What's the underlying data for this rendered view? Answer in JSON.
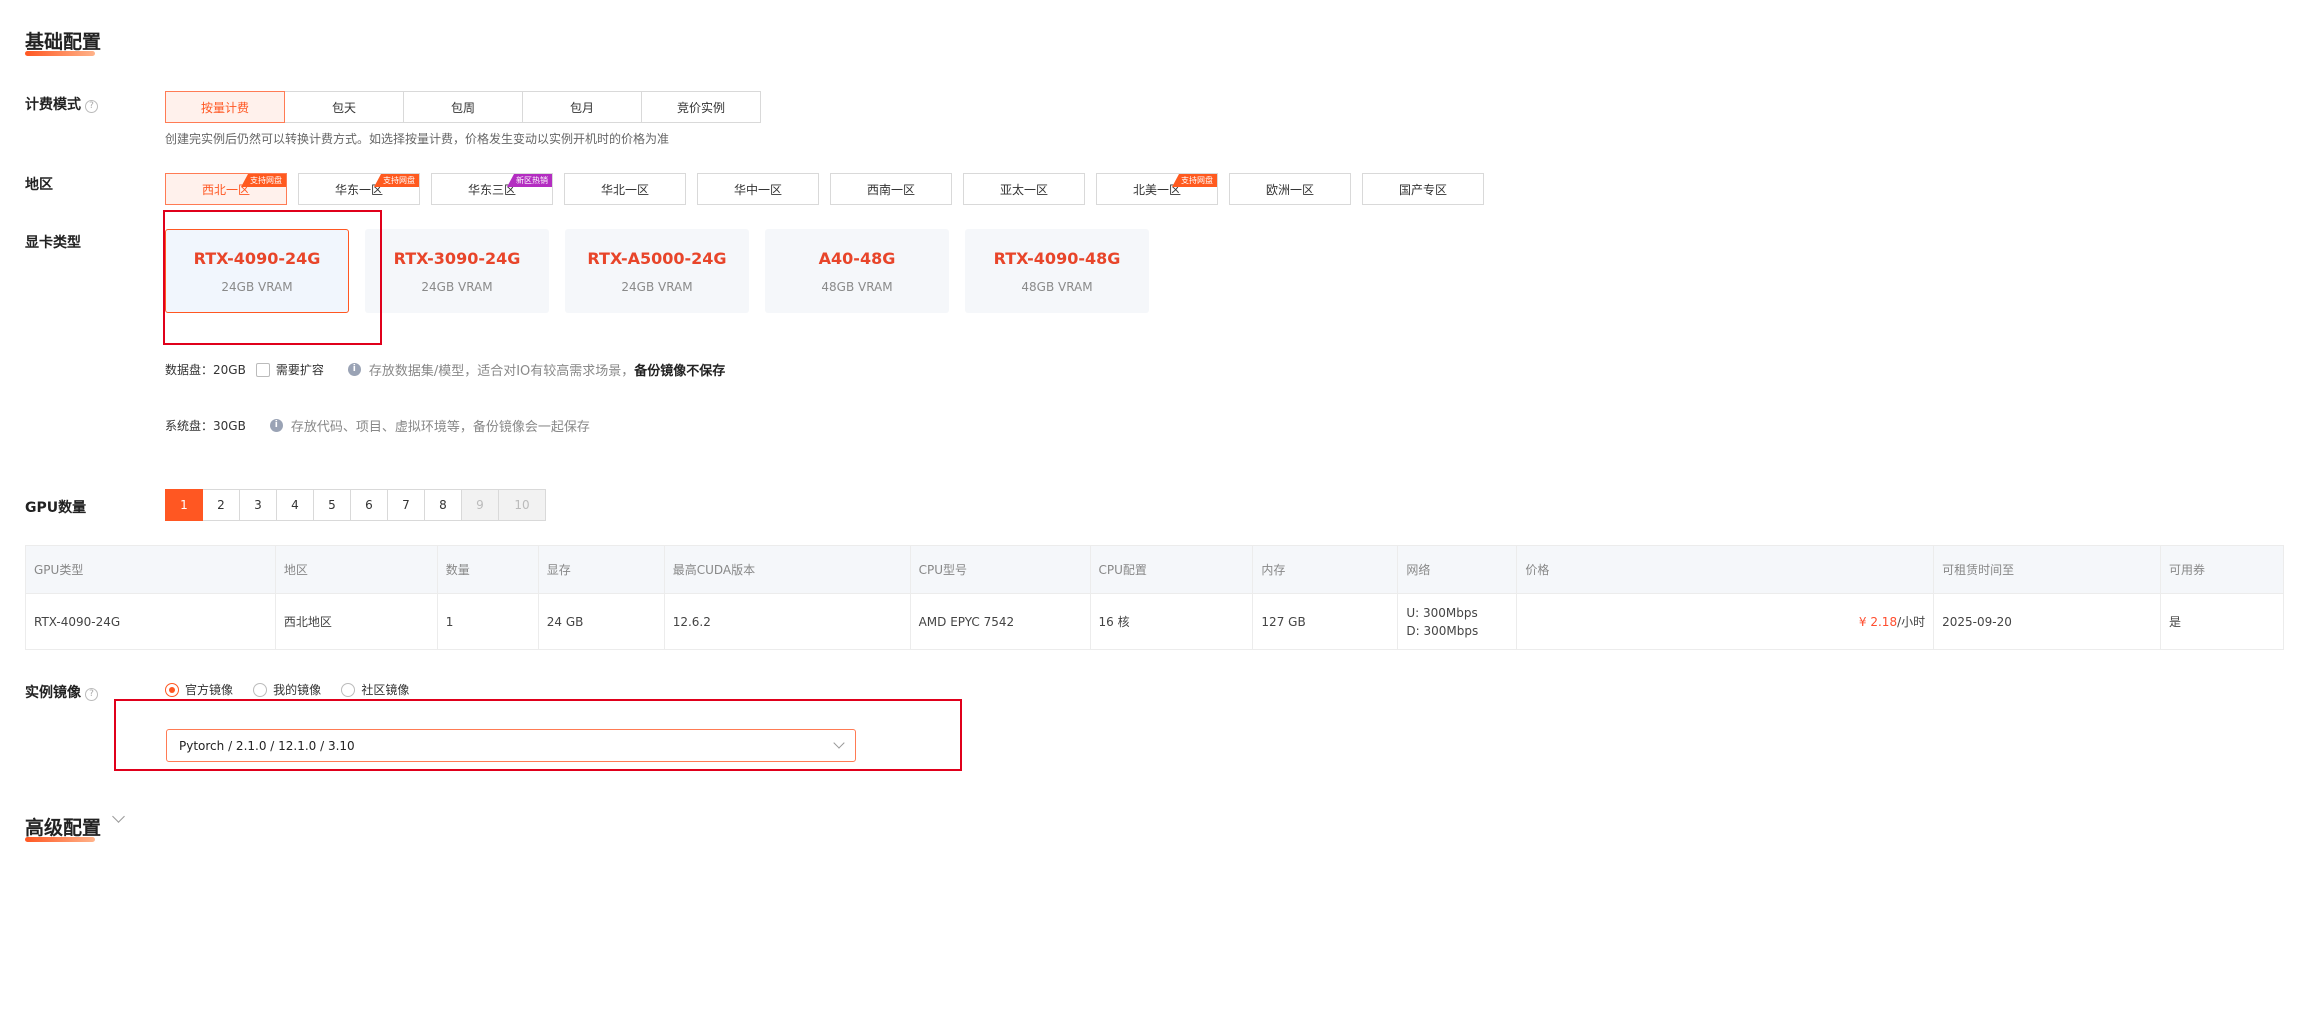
{
  "basic": {
    "title": "基础配置",
    "billing": {
      "label": "计费模式",
      "help": "?",
      "options": [
        "按量计费",
        "包天",
        "包周",
        "包月",
        "竞价实例"
      ],
      "selected": "按量计费",
      "hint": "创建完实例后仍然可以转换计费方式。如选择按量计费，价格发生变动以实例开机时的价格为准"
    },
    "region": {
      "label": "地区",
      "options": [
        {
          "name": "西北一区",
          "badge": "支持网盘",
          "active": true
        },
        {
          "name": "华东一区",
          "badge": "支持网盘"
        },
        {
          "name": "华东三区",
          "badge": "新区热销"
        },
        {
          "name": "华北一区"
        },
        {
          "name": "华中一区"
        },
        {
          "name": "西南一区"
        },
        {
          "name": "亚太一区"
        },
        {
          "name": "北美一区",
          "badge": "支持网盘"
        },
        {
          "name": "欧洲一区"
        },
        {
          "name": "国产专区"
        }
      ]
    },
    "gpu_type": {
      "label": "显卡类型",
      "cards": [
        {
          "name": "RTX-4090-24G",
          "vram": "24GB VRAM",
          "active": true
        },
        {
          "name": "RTX-3090-24G",
          "vram": "24GB VRAM"
        },
        {
          "name": "RTX-A5000-24G",
          "vram": "24GB VRAM"
        },
        {
          "name": "A40-48G",
          "vram": "48GB VRAM"
        },
        {
          "name": "RTX-4090-48G",
          "vram": "48GB VRAM"
        }
      ]
    },
    "data_disk": {
      "label": "数据盘：",
      "size": "20GB",
      "expand_label": "需要扩容",
      "info_icon": "i",
      "info": "存放数据集/模型，适合对IO有较高需求场景，",
      "info_strong": "备份镜像不保存"
    },
    "system_disk": {
      "label": "系统盘：",
      "size": "30GB",
      "info_icon": "i",
      "info": "存放代码、项目、虚拟环境等，备份镜像会一起保存"
    },
    "gpu_count": {
      "label": "GPU数量",
      "options": [
        "1",
        "2",
        "3",
        "4",
        "5",
        "6",
        "7",
        "8",
        "9",
        "10"
      ],
      "selected": "1",
      "disabled": [
        "9",
        "10"
      ]
    },
    "table": {
      "headers": [
        "GPU类型",
        "地区",
        "数量",
        "显存",
        "最高CUDA版本",
        "CPU型号",
        "CPU配置",
        "内存",
        "网络",
        "价格",
        "可租赁时间至",
        "可用券"
      ],
      "row": {
        "gpu": "RTX-4090-24G",
        "region": "西北地区",
        "count": "1",
        "vram": "24 GB",
        "cuda": "12.6.2",
        "cpu_model": "AMD EPYC 7542",
        "cpu_config": "16 核",
        "memory": "127 GB",
        "net_up": "U: 300Mbps",
        "net_down": "D: 300Mbps",
        "price": "¥ 2.18",
        "price_unit": "/小时",
        "lease_until": "2025-09-20",
        "coupon": "是"
      }
    },
    "image": {
      "label": "实例镜像",
      "help": "?",
      "options": [
        "官方镜像",
        "我的镜像",
        "社区镜像"
      ],
      "selected": "官方镜像",
      "value": "Pytorch / 2.1.0 / 12.1.0 / 3.10"
    }
  },
  "advanced": {
    "title": "高级配置"
  },
  "colors": {
    "accent": "#ff5722",
    "highlight_box": "#e0001b"
  }
}
